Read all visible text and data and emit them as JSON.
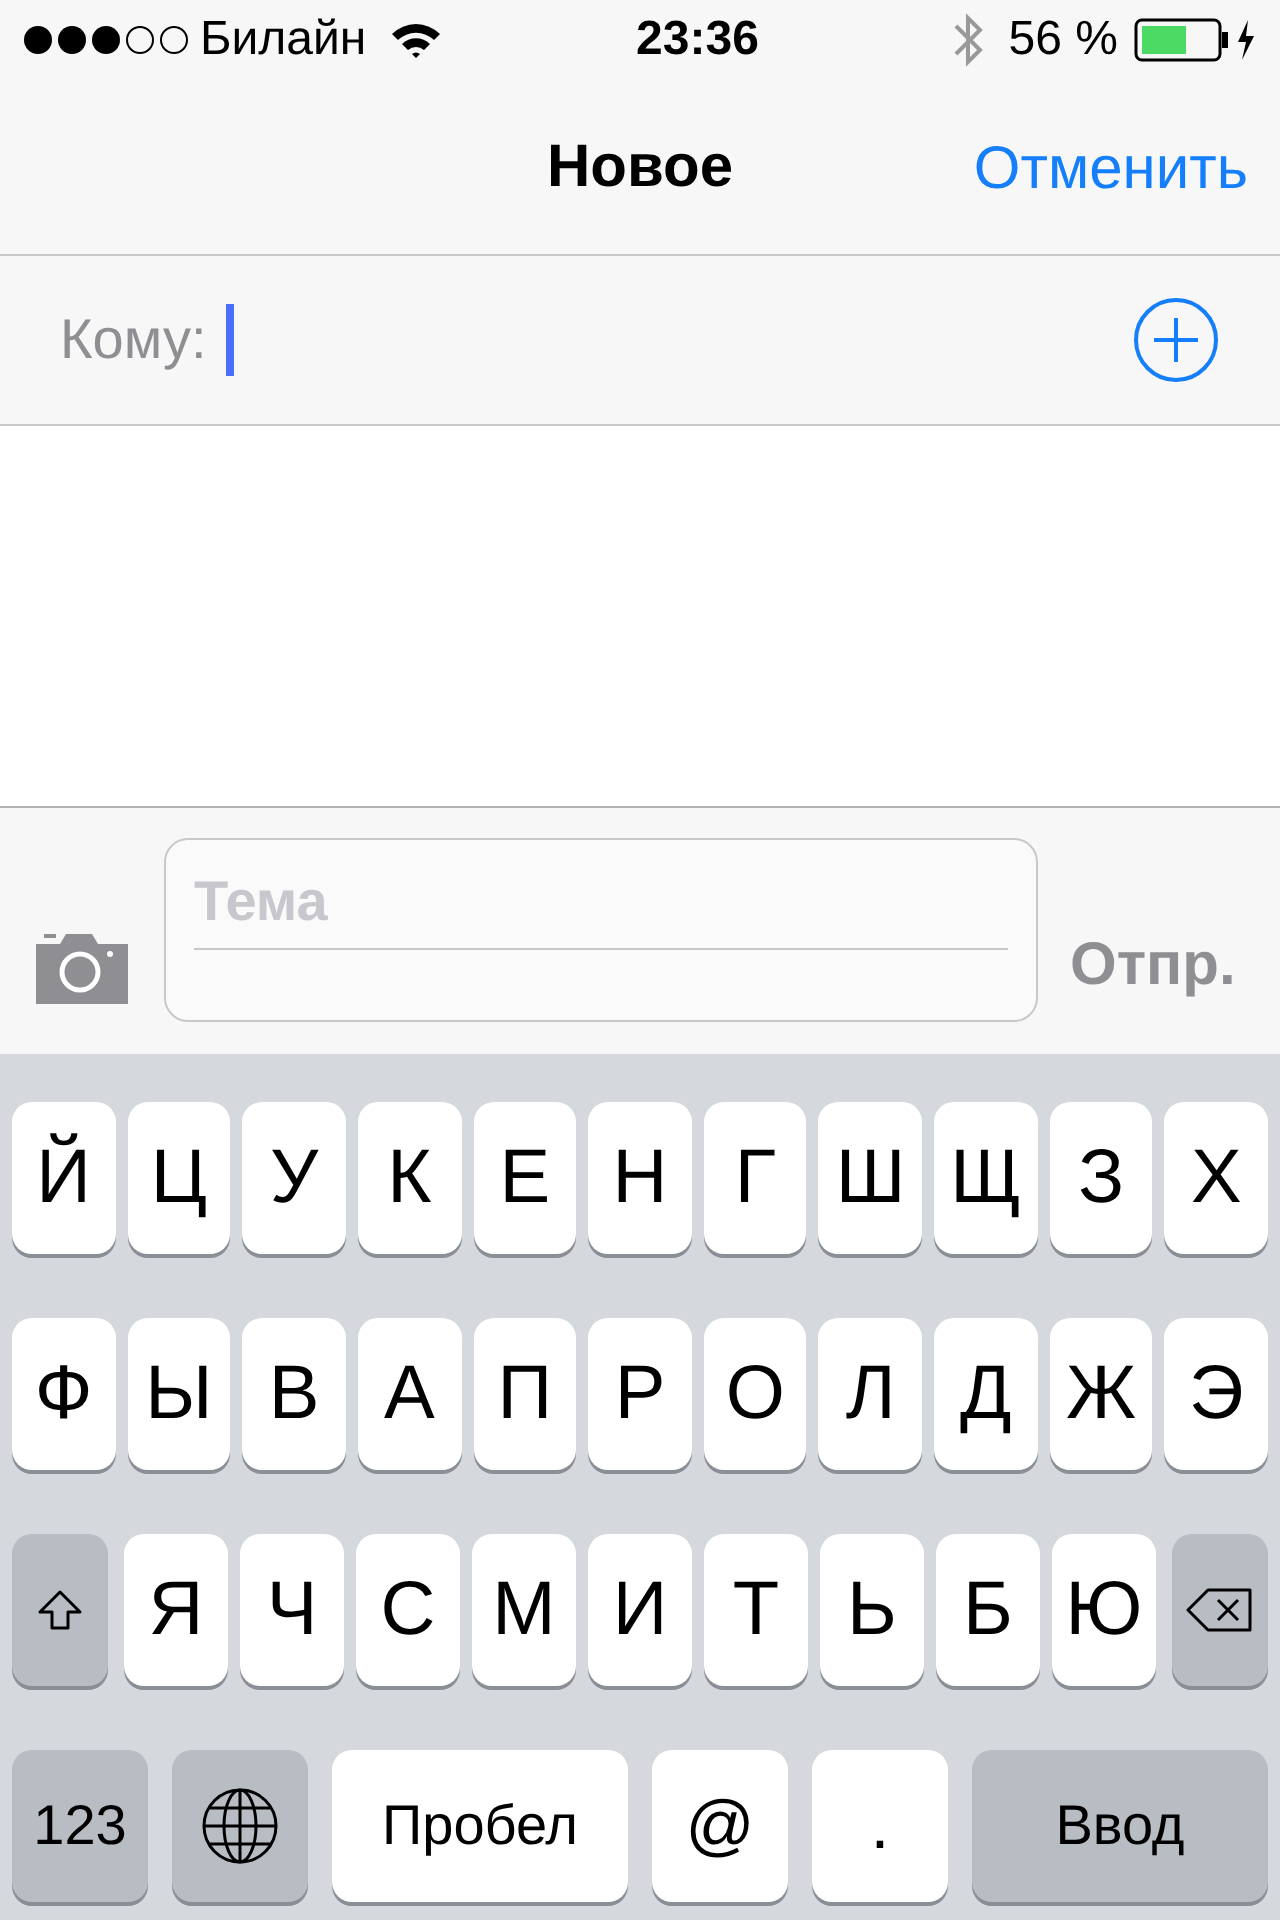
{
  "status_bar": {
    "carrier": "Билайн",
    "time": "23:36",
    "battery_percent": "56 %"
  },
  "nav_bar": {
    "title": "Новое",
    "cancel": "Отменить"
  },
  "to_field": {
    "label": "Кому:"
  },
  "compose_bar": {
    "subject_placeholder": "Тема",
    "send": "Отпр.",
    "send_disabled": true
  },
  "keyboard": {
    "rows": [
      [
        {
          "kind": "letter",
          "label": "Й"
        },
        {
          "kind": "letter",
          "label": "Ц"
        },
        {
          "kind": "letter",
          "label": "У"
        },
        {
          "kind": "letter",
          "label": "К"
        },
        {
          "kind": "letter",
          "label": "Е"
        },
        {
          "kind": "letter",
          "label": "Н"
        },
        {
          "kind": "letter",
          "label": "Г"
        },
        {
          "kind": "letter",
          "label": "Ш"
        },
        {
          "kind": "letter",
          "label": "Щ"
        },
        {
          "kind": "letter",
          "label": "З"
        },
        {
          "kind": "letter",
          "label": "Х"
        }
      ],
      [
        {
          "kind": "letter",
          "label": "Ф"
        },
        {
          "kind": "letter",
          "label": "Ы"
        },
        {
          "kind": "letter",
          "label": "В"
        },
        {
          "kind": "letter",
          "label": "А"
        },
        {
          "kind": "letter",
          "label": "П"
        },
        {
          "kind": "letter",
          "label": "Р"
        },
        {
          "kind": "letter",
          "label": "О"
        },
        {
          "kind": "letter",
          "label": "Л"
        },
        {
          "kind": "letter",
          "label": "Д"
        },
        {
          "kind": "letter",
          "label": "Ж"
        },
        {
          "kind": "letter",
          "label": "Э"
        }
      ],
      [
        {
          "kind": "shift"
        },
        {
          "kind": "letter",
          "label": "Я"
        },
        {
          "kind": "letter",
          "label": "Ч"
        },
        {
          "kind": "letter",
          "label": "С"
        },
        {
          "kind": "letter",
          "label": "М"
        },
        {
          "kind": "letter",
          "label": "И"
        },
        {
          "kind": "letter",
          "label": "Т"
        },
        {
          "kind": "letter",
          "label": "Ь"
        },
        {
          "kind": "letter",
          "label": "Б"
        },
        {
          "kind": "letter",
          "label": "Ю"
        },
        {
          "kind": "delete"
        }
      ]
    ],
    "bottom_row": [
      {
        "kind": "mode",
        "label": "123"
      },
      {
        "kind": "globe"
      },
      {
        "kind": "space",
        "label": "Пробел"
      },
      {
        "kind": "symbol",
        "label": "@"
      },
      {
        "kind": "symbol",
        "label": "."
      },
      {
        "kind": "return",
        "label": "Ввод"
      }
    ]
  }
}
